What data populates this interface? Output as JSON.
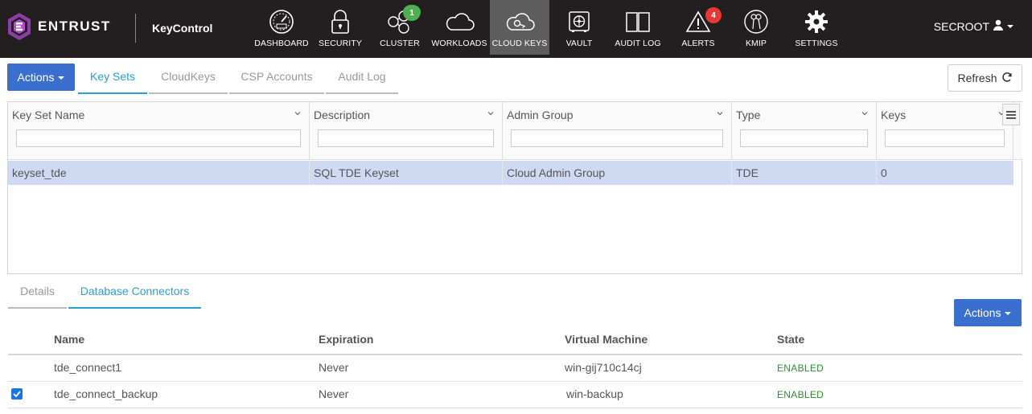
{
  "header": {
    "brand": "ENTRUST",
    "product": "KeyControl",
    "user": "SECROOT",
    "nav": [
      {
        "label": "DASHBOARD",
        "icon": "dashboard-gauge-icon"
      },
      {
        "label": "SECURITY",
        "icon": "lock-icon"
      },
      {
        "label": "CLUSTER",
        "icon": "cluster-icon",
        "badge": "1"
      },
      {
        "label": "WORKLOADS",
        "icon": "cloud-icon"
      },
      {
        "label": "CLOUD KEYS",
        "icon": "cloud-key-icon",
        "active": true
      },
      {
        "label": "VAULT",
        "icon": "vault-icon"
      },
      {
        "label": "AUDIT LOG",
        "icon": "book-icon"
      },
      {
        "label": "ALERTS",
        "icon": "warning-icon",
        "badge": "4"
      },
      {
        "label": "KMIP",
        "icon": "kmip-keys-icon"
      },
      {
        "label": "SETTINGS",
        "icon": "gear-icon"
      }
    ]
  },
  "toolbar": {
    "actions_label": "Actions",
    "tabs": [
      "Key Sets",
      "CloudKeys",
      "CSP Accounts",
      "Audit Log"
    ],
    "refresh_label": "Refresh"
  },
  "keysets": {
    "columns": [
      "Key Set Name",
      "Description",
      "Admin Group",
      "Type",
      "Keys"
    ],
    "rows": [
      {
        "name": "keyset_tde",
        "description": "SQL TDE Keyset",
        "admin_group": "Cloud Admin Group",
        "type": "TDE",
        "keys": "0"
      }
    ]
  },
  "details": {
    "tabs": [
      "Details",
      "Database Connectors"
    ],
    "actions_label": "Actions",
    "columns": [
      "Name",
      "Expiration",
      "Virtual Machine",
      "State"
    ],
    "rows": [
      {
        "checked": false,
        "name": "tde_connect1",
        "expiration": "Never",
        "vm": "win-gij710c14cj",
        "state": "ENABLED"
      },
      {
        "checked": true,
        "name": "tde_connect_backup",
        "expiration": "Never",
        "vm": "win-backup",
        "state": "ENABLED"
      }
    ]
  },
  "colors": {
    "navbar": "#231f20",
    "active_nav": "#5d5d5d",
    "primary_button": "#3b6fcf",
    "tab_active": "#2a9fd6",
    "selected_row": "#cfd9f2",
    "enabled": "#2f8f2f",
    "badge_green": "#4caf50",
    "badge_red": "#e53935",
    "brand_purple": "#8e3ea8"
  }
}
